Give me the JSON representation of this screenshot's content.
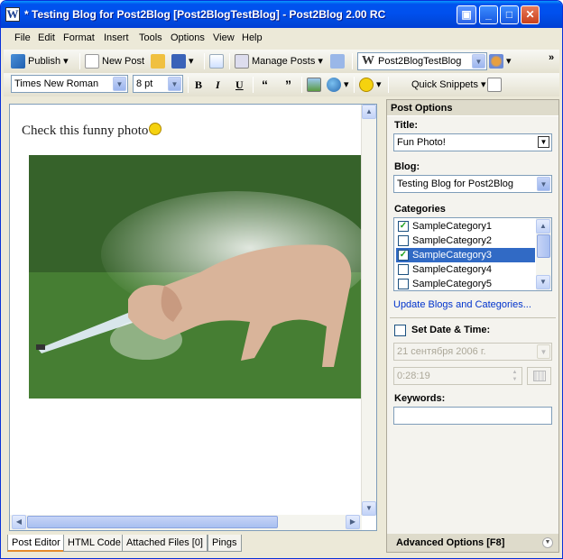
{
  "window": {
    "title": "* Testing Blog for Post2Blog [Post2BlogTestBlog] - Post2Blog 2.00 RC",
    "app_icon": "W"
  },
  "menu": [
    "File",
    "Edit",
    "Format",
    "Insert",
    "Tools",
    "Options",
    "View",
    "Help"
  ],
  "toolbar1": {
    "publish": "Publish",
    "new_post": "New Post",
    "manage_posts": "Manage Posts",
    "blog_select": "Post2BlogTestBlog",
    "overflow": "»"
  },
  "toolbar2": {
    "font": "Times New Roman",
    "size": "8 pt",
    "bold": "B",
    "italic": "I",
    "underline": "U",
    "quote_open": "“",
    "quote_close": "”",
    "quick_snippets": "Quick Snippets"
  },
  "editor": {
    "text": "Check this funny photo"
  },
  "tabs": [
    "Post Editor",
    "HTML Code",
    "Attached Files [0]",
    "Pings"
  ],
  "panel": {
    "header": "Post Options",
    "title_label": "Title:",
    "title_value": "Fun Photo!",
    "blog_label": "Blog:",
    "blog_value": "Testing Blog for Post2Blog",
    "categories_label": "Categories",
    "categories": [
      {
        "name": "SampleCategory1",
        "checked": true,
        "selected": false
      },
      {
        "name": "SampleCategory2",
        "checked": false,
        "selected": false
      },
      {
        "name": "SampleCategory3",
        "checked": true,
        "selected": true
      },
      {
        "name": "SampleCategory4",
        "checked": false,
        "selected": false
      },
      {
        "name": "SampleCategory5",
        "checked": false,
        "selected": false
      }
    ],
    "update_link": "Update Blogs and Categories...",
    "set_date_label": "Set Date & Time:",
    "date_value": "21 сентября 2006 г.",
    "time_value": "0:28:19",
    "keywords_label": "Keywords:",
    "keywords_value": "",
    "advanced": "Advanced Options [F8]"
  },
  "colors": {
    "titlebar": "#0053ee",
    "selection": "#316ac5",
    "link": "#0033cc",
    "tab_accent": "#e68b2c"
  }
}
